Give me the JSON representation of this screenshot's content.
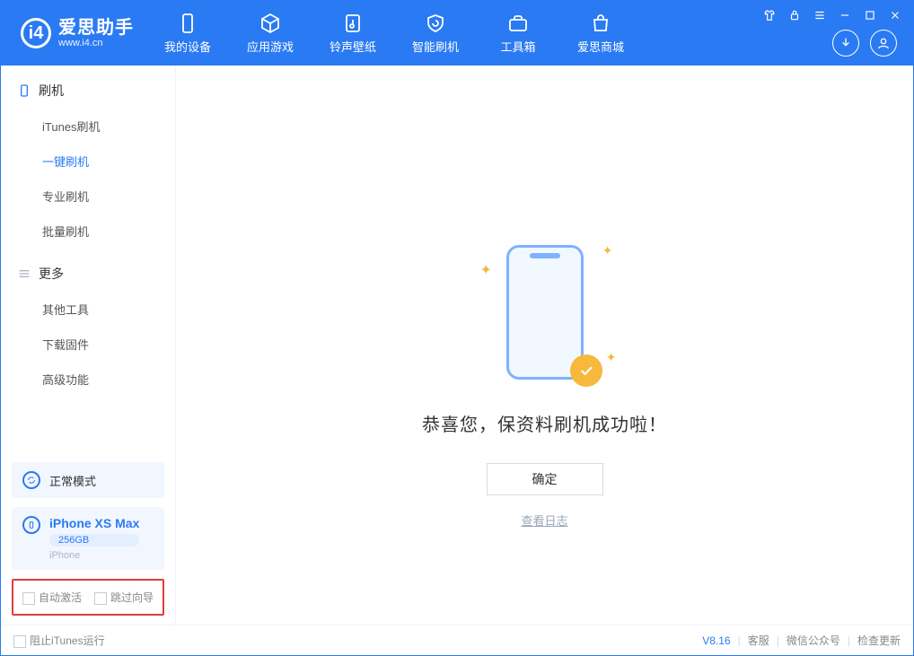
{
  "app": {
    "name": "爱思助手",
    "domain": "www.i4.cn"
  },
  "tabs": [
    {
      "label": "我的设备"
    },
    {
      "label": "应用游戏"
    },
    {
      "label": "铃声壁纸"
    },
    {
      "label": "智能刷机"
    },
    {
      "label": "工具箱"
    },
    {
      "label": "爱思商城"
    }
  ],
  "sidebar": {
    "group1_title": "刷机",
    "group1": [
      {
        "label": "iTunes刷机"
      },
      {
        "label": "一键刷机"
      },
      {
        "label": "专业刷机"
      },
      {
        "label": "批量刷机"
      }
    ],
    "group2_title": "更多",
    "group2": [
      {
        "label": "其他工具"
      },
      {
        "label": "下载固件"
      },
      {
        "label": "高级功能"
      }
    ],
    "mode_label": "正常模式",
    "device": {
      "name": "iPhone XS Max",
      "storage": "256GB",
      "type": "iPhone"
    },
    "opt_auto_activate": "自动激活",
    "opt_skip_guide": "跳过向导"
  },
  "main": {
    "success_title": "恭喜您，保资料刷机成功啦！",
    "ok_label": "确定",
    "log_link": "查看日志"
  },
  "footer": {
    "block_itunes": "阻止iTunes运行",
    "version": "V8.16",
    "support": "客服",
    "wechat": "微信公众号",
    "check_update": "检查更新"
  }
}
